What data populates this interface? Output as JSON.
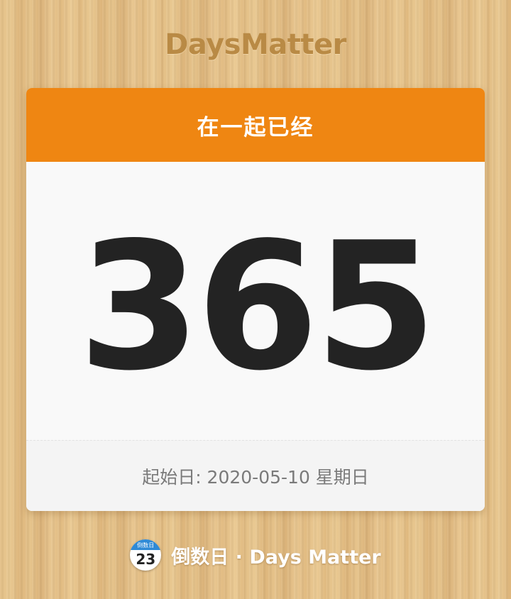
{
  "brand": {
    "title": "DaysMatter"
  },
  "card": {
    "header_title": "在一起已经",
    "day_count": "365",
    "start_date": "起始日: 2020-05-10 星期日"
  },
  "app_badge": {
    "icon_top": "倒数日",
    "icon_day": "23",
    "label": "倒数日 · Days Matter"
  },
  "colors": {
    "header": "#ef8612",
    "brand": "#b98a45",
    "count": "#232323",
    "wood": "#e3bf86"
  },
  "icons": {
    "app": "calendar-app-icon"
  }
}
